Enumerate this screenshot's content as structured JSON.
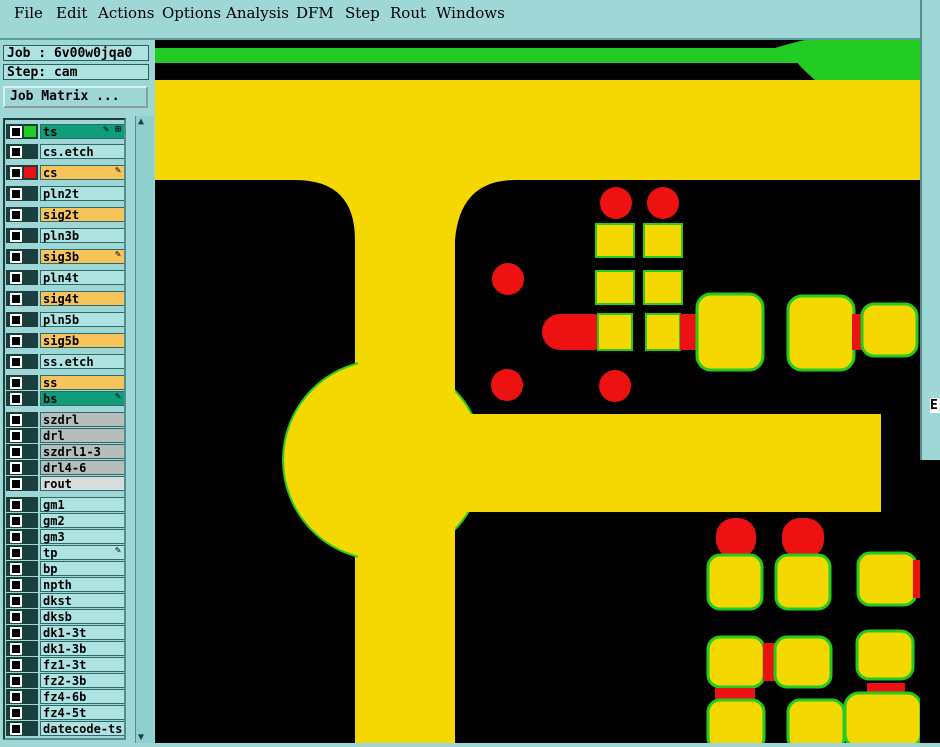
{
  "menu": [
    "File",
    "Edit",
    "Actions",
    "Options",
    "Analysis",
    "DFM",
    "Step",
    "Rout",
    "Windows"
  ],
  "job_label": "Job : 6v00w0jqa0",
  "step_label": "Step: cam",
  "job_matrix_button": "Job Matrix ...",
  "layers": [
    {
      "name": "ts",
      "color": "#0f9d7a",
      "swatch": "#22cc22",
      "flag": "✎ ⊞"
    },
    {
      "name": "cs.etch",
      "color": "#aee3e2",
      "swatch": "",
      "flag": ""
    },
    {
      "name": "cs",
      "color": "#f7c45a",
      "swatch": "#ee1111",
      "flag": "✎"
    },
    {
      "name": "pln2t",
      "color": "#aee3e2",
      "swatch": "",
      "flag": ""
    },
    {
      "name": "sig2t",
      "color": "#f7c45a",
      "swatch": "",
      "flag": ""
    },
    {
      "name": "pln3b",
      "color": "#aee3e2",
      "swatch": "",
      "flag": ""
    },
    {
      "name": "sig3b",
      "color": "#f7c45a",
      "swatch": "",
      "flag": "✎"
    },
    {
      "name": "pln4t",
      "color": "#aee3e2",
      "swatch": "",
      "flag": ""
    },
    {
      "name": "sig4t",
      "color": "#f7c45a",
      "swatch": "",
      "flag": ""
    },
    {
      "name": "pln5b",
      "color": "#aee3e2",
      "swatch": "",
      "flag": ""
    },
    {
      "name": "sig5b",
      "color": "#f7c45a",
      "swatch": "",
      "flag": ""
    },
    {
      "name": "ss.etch",
      "color": "#aee3e2",
      "swatch": "",
      "flag": ""
    },
    {
      "name": "ss",
      "color": "#f7c45a",
      "swatch": "",
      "flag": ""
    },
    {
      "name": "bs",
      "color": "#0f9d7a",
      "swatch": "",
      "flag": "✎"
    },
    {
      "name": "szdrl",
      "color": "#b5bdbd",
      "swatch": "",
      "flag": ""
    },
    {
      "name": "drl",
      "color": "#b5bdbd",
      "swatch": "",
      "flag": ""
    },
    {
      "name": "szdrl1-3",
      "color": "#b5bdbd",
      "swatch": "",
      "flag": ""
    },
    {
      "name": "drl4-6",
      "color": "#b5bdbd",
      "swatch": "",
      "flag": ""
    },
    {
      "name": "rout",
      "color": "#d7dcdc",
      "swatch": "",
      "flag": ""
    },
    {
      "name": "gm1",
      "color": "#aee3e2",
      "swatch": "",
      "flag": ""
    },
    {
      "name": "gm2",
      "color": "#aee3e2",
      "swatch": "",
      "flag": ""
    },
    {
      "name": "gm3",
      "color": "#aee3e2",
      "swatch": "",
      "flag": ""
    },
    {
      "name": "tp",
      "color": "#aee3e2",
      "swatch": "",
      "flag": "✎"
    },
    {
      "name": "bp",
      "color": "#aee3e2",
      "swatch": "",
      "flag": ""
    },
    {
      "name": "npth",
      "color": "#aee3e2",
      "swatch": "",
      "flag": ""
    },
    {
      "name": "dkst",
      "color": "#aee3e2",
      "swatch": "",
      "flag": ""
    },
    {
      "name": "dksb",
      "color": "#aee3e2",
      "swatch": "",
      "flag": ""
    },
    {
      "name": "dk1-3t",
      "color": "#aee3e2",
      "swatch": "",
      "flag": ""
    },
    {
      "name": "dk1-3b",
      "color": "#aee3e2",
      "swatch": "",
      "flag": ""
    },
    {
      "name": "fz1-3t",
      "color": "#aee3e2",
      "swatch": "",
      "flag": ""
    },
    {
      "name": "fz2-3b",
      "color": "#aee3e2",
      "swatch": "",
      "flag": ""
    },
    {
      "name": "fz4-6b",
      "color": "#aee3e2",
      "swatch": "",
      "flag": ""
    },
    {
      "name": "fz4-5t",
      "color": "#aee3e2",
      "swatch": "",
      "flag": ""
    },
    {
      "name": "datecode-ts",
      "color": "#aee3e2",
      "swatch": "",
      "flag": ""
    }
  ],
  "scroll_up_icon": "triangle-up",
  "scroll_down_icon": "triangle-down",
  "colors": {
    "copper": "#f5d800",
    "outline": "#22cc22",
    "pad_red": "#ee1111",
    "background": "#000000"
  },
  "right_panel_text": "E"
}
